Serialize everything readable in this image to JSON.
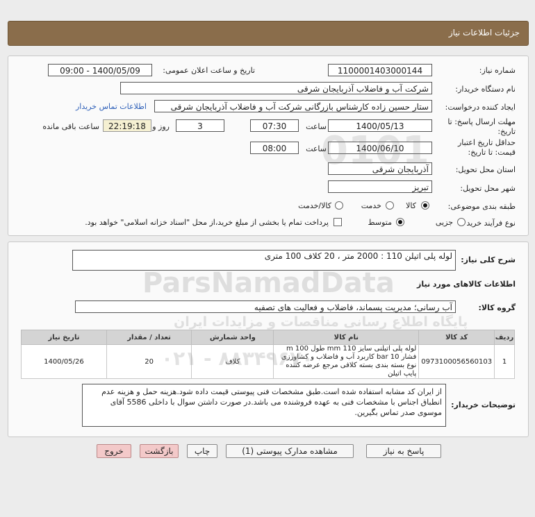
{
  "header": {
    "title": "جزئیات اطلاعات نیاز"
  },
  "info": {
    "need_number_label": "شماره نیاز:",
    "need_number": "1100001403000144",
    "announce_label": "تاریخ و ساعت اعلان عمومی:",
    "announce_value": "1400/05/09 - 09:00",
    "buyer_label": "نام دستگاه خریدار:",
    "buyer_value": "شرکت آب و فاضلاب آذربایجان شرقی",
    "creator_label": "ایجاد کننده درخواست:",
    "creator_value": "ستار حسین زاده کارشناس بازرگانی شرکت آب و فاضلاب آذربایجان شرقی",
    "contact_link": "اطلاعات تماس خریدار",
    "deadline_label_1": "مهلت ارسال پاسخ: تا",
    "deadline_label_2": "تاریخ:",
    "deadline_date": "1400/05/13",
    "time_label": "ساعت",
    "deadline_time": "07:30",
    "days_value": "3",
    "days_label": "روز و",
    "remaining_time": "22:19:18",
    "remaining_label": "ساعت باقی مانده",
    "validity_label_1": "حداقل تاریخ اعتبار",
    "validity_label_2": "قیمت: تا تاریخ:",
    "validity_date": "1400/06/10",
    "validity_time": "08:00",
    "province_label": "استان محل تحویل:",
    "province_value": "آذربایجان شرقی",
    "city_label": "شهر محل تحویل:",
    "city_value": "تبریز",
    "category_label": "طبقه بندی موضوعی:",
    "category_options": [
      "کالا",
      "خدمت",
      "کالا/خدمت"
    ],
    "process_label": "نوع فرآیند خرید :",
    "process_options": [
      "جزیی",
      "متوسط"
    ],
    "payment_note": "پرداخت تمام یا بخشی از مبلغ خرید،از محل \"اسناد خزانه اسلامی\" خواهد بود."
  },
  "summary": {
    "desc_label": "شرح کلی نیاز:",
    "desc_value": "لوله پلی اتیلن 110 : 2000 متر ، 20 کلاف 100 متری",
    "goods_info_title": "اطلاعات کالاهای مورد نیاز",
    "group_label": "گروه کالا:",
    "group_value": "آب رسانی؛ مدیریت پسماند، فاضلاب و فعالیت های تصفیه"
  },
  "table": {
    "headers": [
      "ردیف",
      "کد کالا",
      "نام کالا",
      "واحد شمارش",
      "تعداد / مقدار",
      "تاریخ نیاز"
    ],
    "rows": [
      {
        "row": "1",
        "code": "0973100056560103",
        "name": "لوله پلی اتیلنی سایز 110 mm طول 100 m فشار 10 bar کاربرد آب و فاضلاب و کشاورزی نوع بسته بندی بسته کلافی مرجع عرضه کننده پایپ اتیلن",
        "unit": "کلاف",
        "qty": "20",
        "date": "1400/05/26"
      }
    ]
  },
  "buyer_notes": {
    "label": "توضیحات خریدار:",
    "text": "از ایران کد مشابه استفاده شده است.طبق مشخصات فنی پیوستی قیمت داده شود.هزینه حمل و هزینه عدم انطباق اجناس با مشخصات فنی به عهده فروشنده می باشد.در صورت داشتن سوال با داخلی 5586 آقای موسوی صدر تماس بگیرین."
  },
  "buttons": {
    "reply": "پاسخ به نیاز",
    "view_docs": "مشاهده مدارک پیوستی (1)",
    "print": "چاپ",
    "back": "بازگشت",
    "exit": "خروج"
  },
  "watermark": {
    "brand": "ParsNamadData",
    "tagline": "پایگاه اطلاع رسانی مناقصات و مزایدات ایران",
    "phone": "۰۲۱ - ۸۸۳۴۹۶۷۰",
    "stamp": "0101"
  }
}
